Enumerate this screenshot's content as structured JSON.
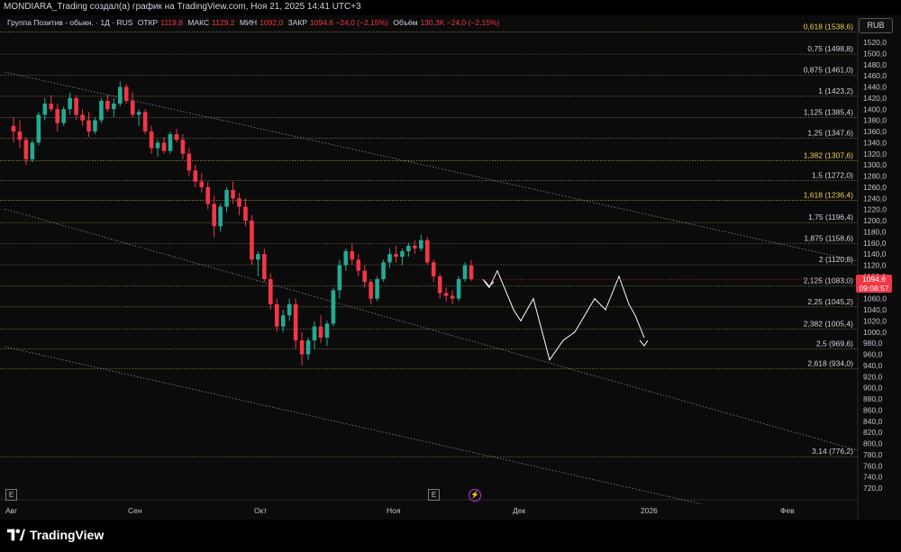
{
  "caption": "MONDIARA_Trading создал(а) график на TradingView.com, Ноя 21, 2025 14:41 UTC+3",
  "legend": {
    "symbol": "Группа Позитив - обыкн. · 1Д · RUS",
    "open_label": "ОТКР",
    "open_value": "1119,8",
    "high_label": "МАКС",
    "high_value": "1129,2",
    "low_label": "МИН",
    "low_value": "1092,0",
    "close_label": "ЗАКР",
    "close_value": "1094,6 −24,0 (−2,15%)",
    "volume_label": "Объём",
    "volume_value": "130,3K −24,0 (−2,15%)"
  },
  "currency_button": "RUB",
  "price_tag": {
    "price": "1094,6",
    "countdown": "09:08:57"
  },
  "brand": "TradingView",
  "icons": {
    "e_left": "E",
    "e_mid": "E",
    "flash": "⚡"
  },
  "colors": {
    "up": "#22ab94",
    "down": "#f23645",
    "fib_line": "#c9c24a",
    "highlight": "#f0d24c",
    "background": "#0b0b0b"
  },
  "chart_data": {
    "type": "candlestick",
    "y_ticks": [
      "1520,0",
      "1500,0",
      "1480,0",
      "1460,0",
      "1440,0",
      "1420,0",
      "1400,0",
      "1380,0",
      "1360,0",
      "1340,0",
      "1320,0",
      "1300,0",
      "1280,0",
      "1260,0",
      "1240,0",
      "1220,0",
      "1200,0",
      "1180,0",
      "1160,0",
      "1140,0",
      "1120,0",
      "1100,0",
      "1080,0",
      "1060,0",
      "1040,0",
      "1020,0",
      "1000,0",
      "980,0",
      "960,0",
      "940,0",
      "920,0",
      "900,0",
      "880,0",
      "860,0",
      "840,0",
      "820,0",
      "800,0",
      "780,0",
      "760,0",
      "740,0",
      "720,0"
    ],
    "x_ticks": [
      "Авг",
      "Сен",
      "Окт",
      "Ноя",
      "Дек",
      "2026",
      "Фев"
    ],
    "fib_levels": [
      {
        "label": "0,618 (1538,6)",
        "price": 1538.6,
        "highlight": true
      },
      {
        "label": "0,75 (1498,8)",
        "price": 1498.8,
        "highlight": false
      },
      {
        "label": "0,875 (1461,0)",
        "price": 1461.0,
        "highlight": false
      },
      {
        "label": "1 (1423,2)",
        "price": 1423.2,
        "highlight": false
      },
      {
        "label": "1,125 (1385,4)",
        "price": 1385.4,
        "highlight": false
      },
      {
        "label": "1,25 (1347,6)",
        "price": 1347.6,
        "highlight": false
      },
      {
        "label": "1,382 (1307,6)",
        "price": 1307.6,
        "highlight": true
      },
      {
        "label": "1,5 (1272,0)",
        "price": 1272.0,
        "highlight": false
      },
      {
        "label": "1,618 (1236,4)",
        "price": 1236.4,
        "highlight": true
      },
      {
        "label": "1,75 (1196,4)",
        "price": 1196.4,
        "highlight": false
      },
      {
        "label": "1,875 (1158,6)",
        "price": 1158.6,
        "highlight": false
      },
      {
        "label": "2 (1120,8)",
        "price": 1120.8,
        "highlight": false
      },
      {
        "label": "2,125 (1083,0)",
        "price": 1083.0,
        "highlight": false
      },
      {
        "label": "2,25 (1045,2)",
        "price": 1045.2,
        "highlight": false
      },
      {
        "label": "2,382 (1005,4)",
        "price": 1005.4,
        "highlight": false
      },
      {
        "label": "2,5 (969,6)",
        "price": 969.6,
        "highlight": false
      },
      {
        "label": "2,618 (934,0)",
        "price": 934.0,
        "highlight": false
      },
      {
        "label": "3,14 (776,2)",
        "price": 776.2,
        "highlight": false
      }
    ],
    "candles": [
      [
        1370,
        1385,
        1340,
        1360
      ],
      [
        1360,
        1380,
        1330,
        1345
      ],
      [
        1345,
        1350,
        1300,
        1310
      ],
      [
        1310,
        1345,
        1305,
        1340
      ],
      [
        1340,
        1395,
        1335,
        1390
      ],
      [
        1390,
        1420,
        1380,
        1410
      ],
      [
        1410,
        1425,
        1395,
        1400
      ],
      [
        1400,
        1410,
        1360,
        1375
      ],
      [
        1375,
        1405,
        1370,
        1400
      ],
      [
        1400,
        1430,
        1390,
        1420
      ],
      [
        1420,
        1425,
        1380,
        1390
      ],
      [
        1390,
        1400,
        1370,
        1380
      ],
      [
        1380,
        1395,
        1350,
        1360
      ],
      [
        1360,
        1385,
        1355,
        1380
      ],
      [
        1380,
        1420,
        1375,
        1415
      ],
      [
        1415,
        1425,
        1395,
        1400
      ],
      [
        1400,
        1420,
        1385,
        1410
      ],
      [
        1410,
        1450,
        1405,
        1440
      ],
      [
        1440,
        1445,
        1410,
        1415
      ],
      [
        1415,
        1430,
        1385,
        1390
      ],
      [
        1390,
        1400,
        1370,
        1395
      ],
      [
        1395,
        1400,
        1355,
        1360
      ],
      [
        1360,
        1370,
        1320,
        1330
      ],
      [
        1330,
        1345,
        1315,
        1340
      ],
      [
        1340,
        1350,
        1320,
        1325
      ],
      [
        1325,
        1360,
        1320,
        1355
      ],
      [
        1355,
        1365,
        1340,
        1345
      ],
      [
        1345,
        1355,
        1310,
        1320
      ],
      [
        1320,
        1330,
        1280,
        1290
      ],
      [
        1290,
        1300,
        1260,
        1270
      ],
      [
        1270,
        1285,
        1250,
        1260
      ],
      [
        1260,
        1270,
        1220,
        1230
      ],
      [
        1230,
        1245,
        1170,
        1190
      ],
      [
        1190,
        1230,
        1180,
        1225
      ],
      [
        1225,
        1260,
        1215,
        1255
      ],
      [
        1255,
        1270,
        1230,
        1240
      ],
      [
        1240,
        1250,
        1210,
        1225
      ],
      [
        1225,
        1240,
        1190,
        1200
      ],
      [
        1200,
        1210,
        1120,
        1130
      ],
      [
        1130,
        1145,
        1100,
        1140
      ],
      [
        1140,
        1150,
        1090,
        1095
      ],
      [
        1095,
        1105,
        1040,
        1050
      ],
      [
        1050,
        1060,
        1000,
        1010
      ],
      [
        1010,
        1040,
        1000,
        1030
      ],
      [
        1030,
        1060,
        1020,
        1050
      ],
      [
        1050,
        1060,
        970,
        985
      ],
      [
        985,
        1000,
        940,
        960
      ],
      [
        960,
        990,
        950,
        985
      ],
      [
        985,
        1020,
        970,
        1010
      ],
      [
        1010,
        1030,
        980,
        990
      ],
      [
        990,
        1020,
        975,
        1015
      ],
      [
        1015,
        1080,
        1010,
        1075
      ],
      [
        1075,
        1130,
        1060,
        1120
      ],
      [
        1120,
        1150,
        1110,
        1145
      ],
      [
        1145,
        1160,
        1120,
        1130
      ],
      [
        1130,
        1140,
        1100,
        1110
      ],
      [
        1110,
        1120,
        1080,
        1090
      ],
      [
        1090,
        1095,
        1050,
        1060
      ],
      [
        1060,
        1100,
        1055,
        1095
      ],
      [
        1095,
        1130,
        1090,
        1125
      ],
      [
        1125,
        1150,
        1115,
        1140
      ],
      [
        1140,
        1155,
        1125,
        1135
      ],
      [
        1135,
        1150,
        1120,
        1145
      ],
      [
        1145,
        1160,
        1135,
        1155
      ],
      [
        1155,
        1165,
        1140,
        1150
      ],
      [
        1150,
        1175,
        1145,
        1165
      ],
      [
        1165,
        1170,
        1120,
        1125
      ],
      [
        1125,
        1130,
        1090,
        1100
      ],
      [
        1100,
        1105,
        1060,
        1070
      ],
      [
        1070,
        1080,
        1055,
        1065
      ],
      [
        1065,
        1075,
        1050,
        1060
      ],
      [
        1060,
        1100,
        1055,
        1095
      ],
      [
        1095,
        1125,
        1090,
        1119.8
      ],
      [
        1119.8,
        1129.2,
        1092,
        1094.6
      ]
    ],
    "projection": [
      [
        1094.6
      ],
      [
        1080
      ],
      [
        1110
      ],
      [
        1040
      ],
      [
        1020
      ],
      [
        1060
      ],
      [
        1000
      ],
      [
        950
      ],
      [
        990
      ],
      [
        960
      ],
      [
        1030
      ],
      [
        1000
      ],
      [
        1080
      ],
      [
        1060
      ],
      [
        1100
      ],
      [
        1050
      ],
      [
        980
      ]
    ],
    "channel_lines": "three parallel descending dotted lines"
  }
}
